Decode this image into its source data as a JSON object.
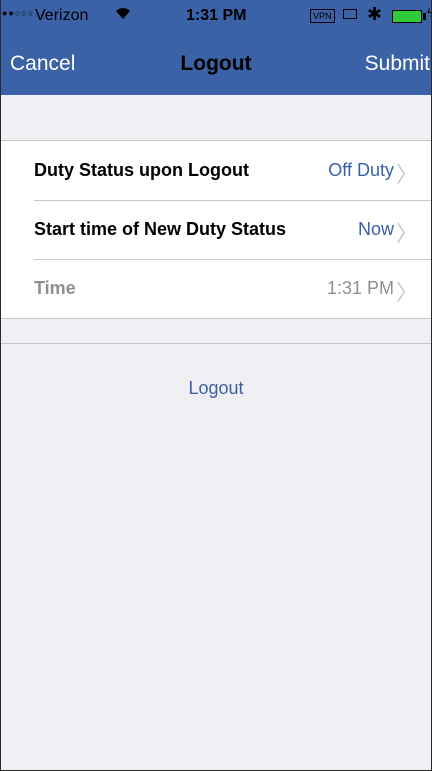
{
  "status_bar": {
    "signal": "●●○○○",
    "carrier": "Verizon",
    "wifi_icon": "wifi-icon",
    "time": "1:31 PM",
    "vpn": "VPN",
    "bluetooth_icon": "bluetooth-icon",
    "battery_icon": "battery-icon",
    "battery_color": "#2ecc3b"
  },
  "nav": {
    "cancel_label": "Cancel",
    "title": "Logout",
    "submit_label": "Submit",
    "bar_color": "#3b61a7"
  },
  "rows": [
    {
      "label": "Duty Status upon Logout",
      "value": "Off Duty",
      "enabled": true
    },
    {
      "label": "Start time of New Duty Status",
      "value": "Now",
      "enabled": true
    },
    {
      "label": "Time",
      "value": "1:31 PM",
      "enabled": false
    }
  ],
  "logout_label": "Logout",
  "colors": {
    "accent": "#3b61a7",
    "background": "#efeff4",
    "muted": "#8e8e93"
  }
}
